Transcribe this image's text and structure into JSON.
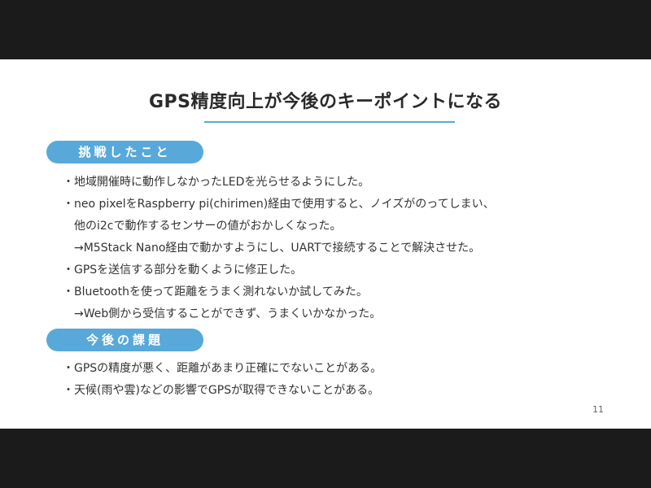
{
  "slide": {
    "title": "GPS精度向上が今後のキーポイントになる",
    "page_number": "11",
    "accent_color": "#58a9d9",
    "sections": [
      {
        "heading": "挑戦したこと",
        "lines": [
          {
            "bullet": "・",
            "text": "地域開催時に動作しなかったLEDを光らせるようにした。"
          },
          {
            "bullet": "・",
            "text": "neo pixelをRaspberry pi(chirimen)経由で使用すると、ノイズがのってしまい、"
          },
          {
            "bullet": "",
            "text": "他のi2cで動作するセンサーの値がおかしくなった。"
          },
          {
            "bullet": "",
            "text": "→M5Stack Nano経由で動かすようにし、UARTで接続することで解決させた。"
          },
          {
            "bullet": "・",
            "text": "GPSを送信する部分を動くように修正した。"
          },
          {
            "bullet": "・",
            "text": "Bluetoothを使って距離をうまく測れないか試してみた。"
          },
          {
            "bullet": "",
            "text": "→Web側から受信することができず、うまくいかなかった。"
          }
        ]
      },
      {
        "heading": "今後の課題",
        "lines": [
          {
            "bullet": "・",
            "text": "GPSの精度が悪く、距離があまり正確にでないことがある。"
          },
          {
            "bullet": "・",
            "text": "天候(雨や雲)などの影響でGPSが取得できないことがある。"
          }
        ]
      }
    ]
  }
}
